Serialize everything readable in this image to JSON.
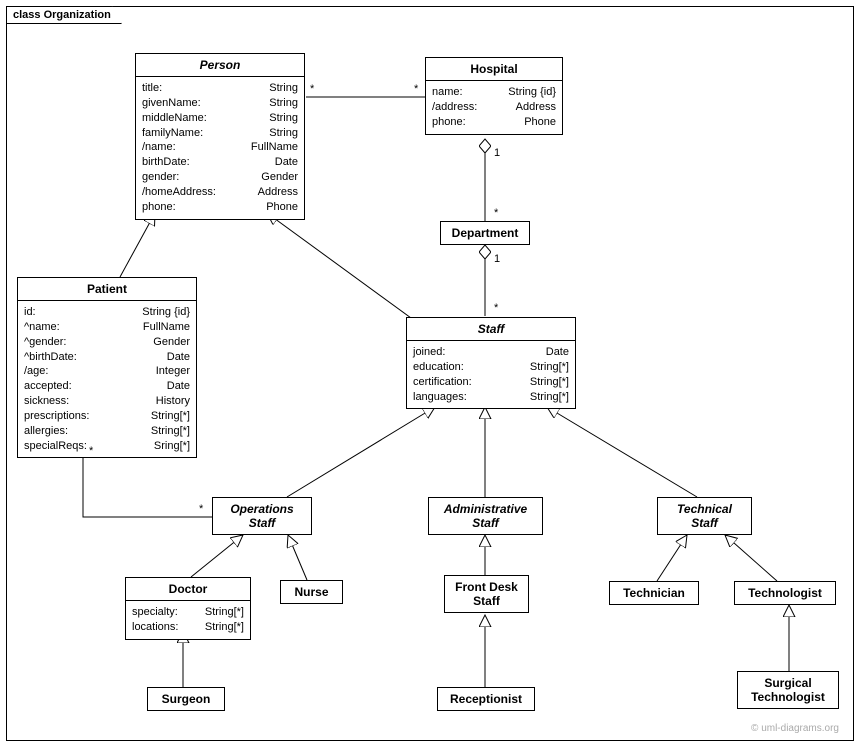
{
  "frameTitle": "class Organization",
  "watermark": "© uml-diagrams.org",
  "classes": {
    "person": {
      "name": "Person",
      "attrs": [
        {
          "n": "title:",
          "t": "String"
        },
        {
          "n": "givenName:",
          "t": "String"
        },
        {
          "n": "middleName:",
          "t": "String"
        },
        {
          "n": "familyName:",
          "t": "String"
        },
        {
          "n": "/name:",
          "t": "FullName"
        },
        {
          "n": "birthDate:",
          "t": "Date"
        },
        {
          "n": "gender:",
          "t": "Gender"
        },
        {
          "n": "/homeAddress:",
          "t": "Address"
        },
        {
          "n": "phone:",
          "t": "Phone"
        }
      ]
    },
    "hospital": {
      "name": "Hospital",
      "attrs": [
        {
          "n": "name:",
          "t": "String {id}"
        },
        {
          "n": "/address:",
          "t": "Address"
        },
        {
          "n": "phone:",
          "t": "Phone"
        }
      ]
    },
    "department": {
      "name": "Department"
    },
    "patient": {
      "name": "Patient",
      "attrs": [
        {
          "n": "id:",
          "t": "String {id}"
        },
        {
          "n": "^name:",
          "t": "FullName"
        },
        {
          "n": "^gender:",
          "t": "Gender"
        },
        {
          "n": "^birthDate:",
          "t": "Date"
        },
        {
          "n": "/age:",
          "t": "Integer"
        },
        {
          "n": "accepted:",
          "t": "Date"
        },
        {
          "n": "sickness:",
          "t": "History"
        },
        {
          "n": "prescriptions:",
          "t": "String[*]"
        },
        {
          "n": "allergies:",
          "t": "String[*]"
        },
        {
          "n": "specialReqs:",
          "t": "Sring[*]"
        }
      ]
    },
    "staff": {
      "name": "Staff",
      "attrs": [
        {
          "n": "joined:",
          "t": "Date"
        },
        {
          "n": "education:",
          "t": "String[*]"
        },
        {
          "n": "certification:",
          "t": "String[*]"
        },
        {
          "n": "languages:",
          "t": "String[*]"
        }
      ]
    },
    "opsStaff": {
      "name": "Operations",
      "name2": "Staff"
    },
    "adminStaff": {
      "name": "Administrative",
      "name2": "Staff"
    },
    "techStaff": {
      "name": "Technical",
      "name2": "Staff"
    },
    "doctor": {
      "name": "Doctor",
      "attrs": [
        {
          "n": "specialty:",
          "t": "String[*]"
        },
        {
          "n": "locations:",
          "t": "String[*]"
        }
      ]
    },
    "nurse": {
      "name": "Nurse"
    },
    "frontDesk": {
      "name": "Front Desk",
      "name2": "Staff"
    },
    "technician": {
      "name": "Technician"
    },
    "technologist": {
      "name": "Technologist"
    },
    "surgeon": {
      "name": "Surgeon"
    },
    "receptionist": {
      "name": "Receptionist"
    },
    "surgTech": {
      "name": "Surgical",
      "name2": "Technologist"
    }
  },
  "mult": {
    "m1": "*",
    "m2": "*",
    "m3": "1",
    "m4": "*",
    "m5": "1",
    "m6": "*",
    "m7": "*",
    "m8": "*"
  }
}
